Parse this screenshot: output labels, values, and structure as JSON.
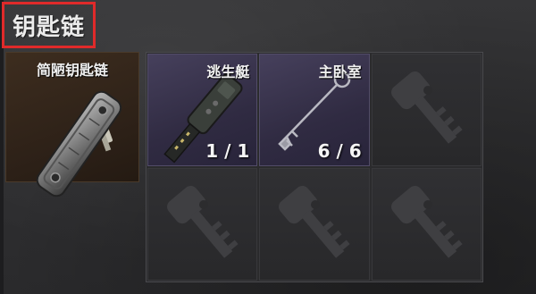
{
  "panel": {
    "title": "钥匙链"
  },
  "main_item": {
    "name": "简陋钥匙链"
  },
  "slots": [
    {
      "name": "逃生艇",
      "count": "1 / 1",
      "filled": true,
      "icon": "fob-key-icon"
    },
    {
      "name": "主卧室",
      "count": "6 / 6",
      "filled": true,
      "icon": "skeleton-key-icon"
    },
    {
      "name": "",
      "count": "",
      "filled": false,
      "icon": "empty-key-slot-icon"
    },
    {
      "name": "",
      "count": "",
      "filled": false,
      "icon": "empty-key-slot-icon"
    },
    {
      "name": "",
      "count": "",
      "filled": false,
      "icon": "empty-key-slot-icon"
    },
    {
      "name": "",
      "count": "",
      "filled": false,
      "icon": "empty-key-slot-icon"
    }
  ],
  "colors": {
    "highlight_border": "#e02a2a",
    "main_slot_bg": "#3d2d1f",
    "filled_slot_bg": "#46405c",
    "empty_slot_bg": "#303033"
  }
}
